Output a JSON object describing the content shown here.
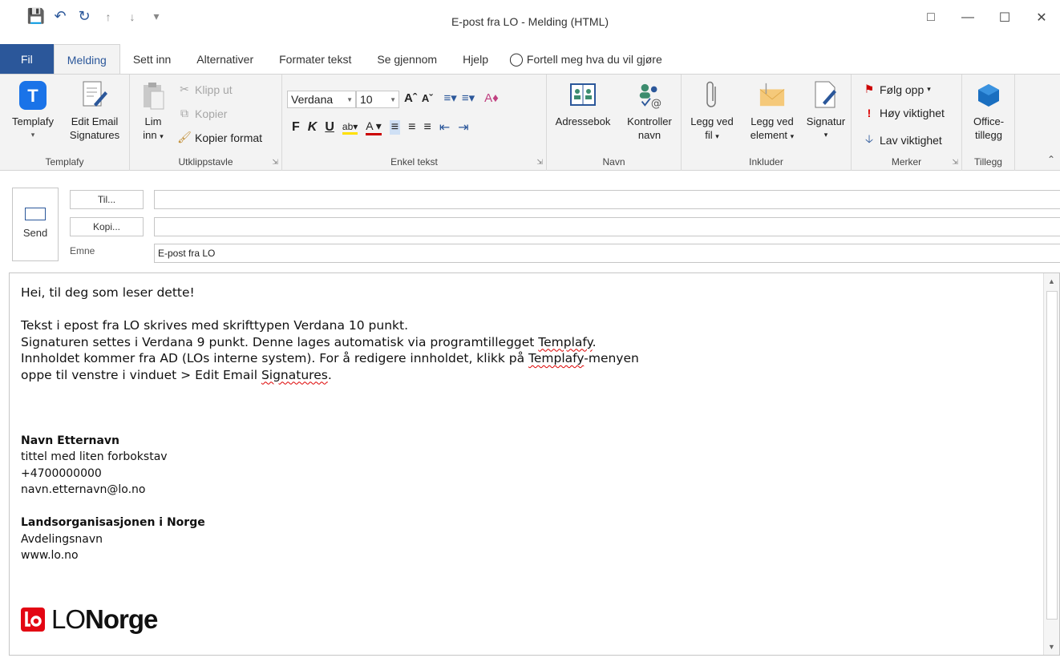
{
  "window": {
    "title": "E-post fra LO  -  Melding (HTML)"
  },
  "tabs": [
    {
      "label": "Fil"
    },
    {
      "label": "Melding"
    },
    {
      "label": "Sett inn"
    },
    {
      "label": "Alternativer"
    },
    {
      "label": "Formater tekst"
    },
    {
      "label": "Se gjennom"
    },
    {
      "label": "Hjelp"
    }
  ],
  "tell_me": "Fortell meg hva du vil gjøre",
  "ribbon": {
    "templafy": {
      "btn1": "Templafy",
      "btn2_line1": "Edit Email",
      "btn2_line2": "Signatures",
      "label": "Templafy"
    },
    "clipboard": {
      "paste_line1": "Lim",
      "paste_line2": "inn",
      "cut": "Klipp ut",
      "copy": "Kopier",
      "format_painter": "Kopier format",
      "label": "Utklippstavle"
    },
    "basic_text": {
      "font": "Verdana",
      "size": "10",
      "label": "Enkel tekst"
    },
    "names": {
      "address_book": "Adressebok",
      "check_names_line1": "Kontroller",
      "check_names_line2": "navn",
      "label": "Navn"
    },
    "include": {
      "attach_file_line1": "Legg ved",
      "attach_file_line2": "fil",
      "attach_item_line1": "Legg ved",
      "attach_item_line2": "element",
      "signature": "Signatur",
      "label": "Inkluder"
    },
    "tags": {
      "follow_up": "Følg opp",
      "high_importance": "Høy viktighet",
      "low_importance": "Lav viktighet",
      "label": "Merker"
    },
    "addins": {
      "office_line1": "Office-",
      "office_line2": "tillegg",
      "label": "Tillegg"
    }
  },
  "compose": {
    "send": "Send",
    "to_button": "Til...",
    "cc_button": "Kopi...",
    "subject_label": "Emne",
    "to_value": "",
    "cc_value": "",
    "subject_value": "E-post fra LO"
  },
  "body": {
    "greeting": "Hei, til deg som leser dette!",
    "line1": "Tekst i epost fra LO skrives med skrifttypen Verdana 10 punkt.",
    "line2_a": "Signaturen settes i Verdana 9 punkt. Denne lages automatisk via programtillegget ",
    "line2_b": "Templafy",
    "line2_c": ".",
    "line3_a": "Innholdet kommer fra AD (LOs interne system). For å redigere innholdet, klikk på ",
    "line3_b": "Templafy",
    "line3_c": "-menyen",
    "line4_a": "oppe til venstre i vinduet > Edit Email ",
    "line4_b": "Signatures",
    "line4_c": ".",
    "sig_name": "Navn Etternavn",
    "sig_title": "tittel med liten forbokstav",
    "sig_phone": "+4700000000",
    "sig_email": "navn.etternavn@lo.no",
    "sig_org": "Landsorganisasjonen i Norge",
    "sig_dept": "Avdelingsnavn",
    "sig_web": "www.lo.no",
    "logo_text_light": "LO",
    "logo_text_bold": "Norge"
  },
  "colors": {
    "accent": "#2b579a",
    "templafy": "#1a73e8",
    "lo_red": "#e30613"
  }
}
